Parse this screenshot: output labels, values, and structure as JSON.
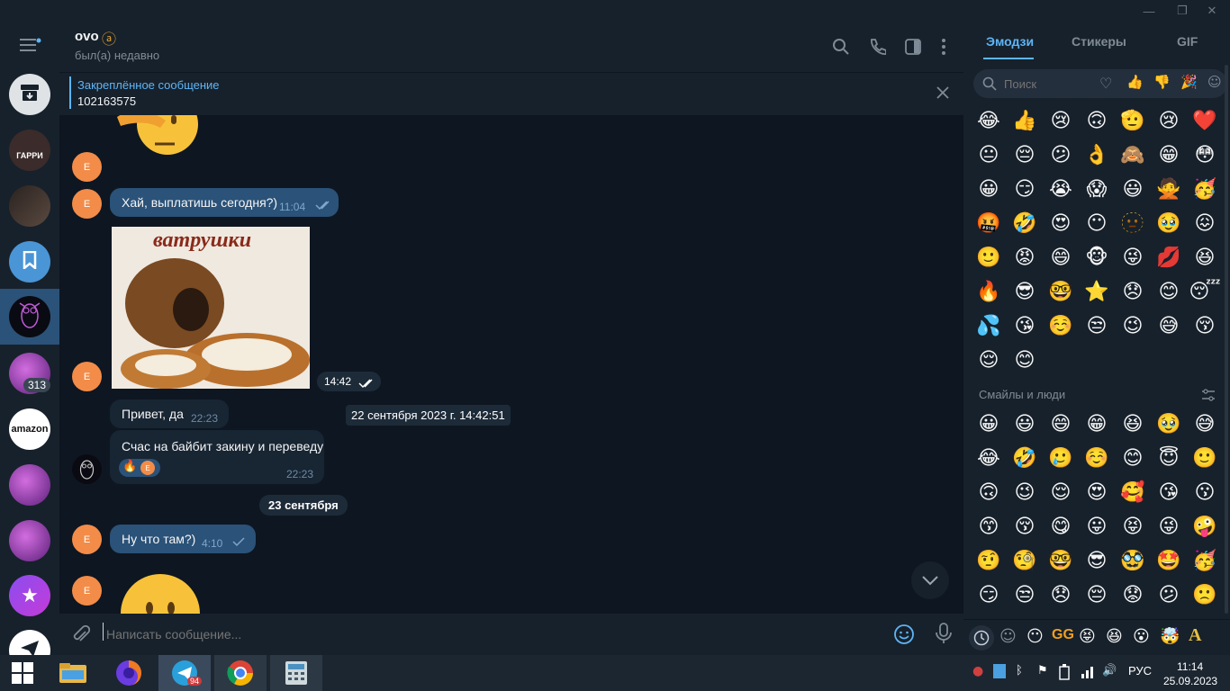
{
  "window": {
    "minimize_glyph": "—",
    "restore_glyph": "❐",
    "close_glyph": "✕"
  },
  "sidebar": {
    "menu_icon": "hamburger-menu-icon",
    "items": [
      {
        "name": "archive",
        "icon": "archive-icon"
      },
      {
        "name": "harry-channel",
        "caption": "ГАРРИ"
      },
      {
        "name": "photo-chat"
      },
      {
        "name": "saved-messages",
        "icon": "bookmark-icon"
      },
      {
        "name": "ovo-chat",
        "selected": true
      },
      {
        "name": "cryptoniks-1",
        "badge": "313"
      },
      {
        "name": "amazon-chat",
        "caption": "amazon"
      },
      {
        "name": "cryptoniks-2"
      },
      {
        "name": "cryptoniks-3"
      },
      {
        "name": "starred-chat"
      },
      {
        "name": "telegram-chat"
      }
    ]
  },
  "header": {
    "title": "ovo",
    "status": "был(а) недавно",
    "icons": [
      "search-icon",
      "phone-icon",
      "sidebar-toggle-icon",
      "more-vertical-icon"
    ]
  },
  "pinned": {
    "label": "Закреплённое сообщение",
    "text": "102163575"
  },
  "messages": [
    {
      "type": "text",
      "text": "Хай, выплатишь сегодня?)",
      "time": "11:04",
      "read": true,
      "avatar": "E"
    },
    {
      "type": "image",
      "caption_art": "ватрушки",
      "time": "14:42",
      "read": true,
      "avatar": "E"
    },
    {
      "type": "text",
      "text": "Привет, да",
      "time": "22:23",
      "avatar": ""
    },
    {
      "type": "tooltip",
      "text": "22 сентября 2023 г. 14:42:51"
    },
    {
      "type": "text",
      "text": "Счас на байбит закину и переведу",
      "time": "22:23",
      "reaction": "🔥",
      "reaction_user": "E"
    },
    {
      "type": "date",
      "text": "23 сентября"
    },
    {
      "type": "text",
      "text": "Ну что там?)",
      "time": "4:10",
      "read": false,
      "avatar": "E"
    }
  ],
  "composer": {
    "placeholder": "Написать сообщение...",
    "icons": [
      "attach-icon",
      "emoji-icon",
      "microphone-icon"
    ]
  },
  "emoji_panel": {
    "tabs": [
      "Эмодзи",
      "Стикеры",
      "GIF"
    ],
    "active_tab": "Эмодзи",
    "search_placeholder": "Поиск",
    "recent": [
      "😂",
      "👍",
      "😢",
      "🙃",
      "🫡",
      "😢",
      "❤️",
      "😐",
      "😔",
      "😕",
      "👌",
      "🙈",
      "😁",
      "😳",
      "😀",
      "😏",
      "😭",
      "😱",
      "😃",
      "🙅",
      "🥳",
      "🤬",
      "🤣",
      "😍",
      "😶",
      "🫥",
      "🥹",
      "😖",
      "🙂",
      "😡",
      "😄",
      "🐵",
      "😜",
      "💋",
      "😆",
      "🔥",
      "😎",
      "🤓",
      "⭐",
      "😞",
      "😊",
      "😴",
      "💦",
      "😘",
      "☺️",
      "😒",
      "😉",
      "😅",
      "😚",
      "😌",
      "😊"
    ],
    "section_title": "Смайлы и люди",
    "people": [
      "😀",
      "😃",
      "😄",
      "😁",
      "😆",
      "🥹",
      "😅",
      "😂",
      "🤣",
      "🥲",
      "☺️",
      "😊",
      "😇",
      "🙂",
      "🙃",
      "😉",
      "😌",
      "😍",
      "🥰",
      "😘",
      "😗",
      "😙",
      "😚",
      "😋",
      "😛",
      "😝",
      "😜",
      "🤪",
      "🤨",
      "🧐",
      "🤓",
      "😎",
      "🥸",
      "🤩",
      "🥳",
      "😏",
      "😒",
      "😞",
      "😔",
      "😟",
      "😕",
      "🙁"
    ],
    "bottom_icons": [
      "recent-clock-icon",
      "smile-category-icon",
      "emoji-pack-icon",
      "gg-sticker-icon",
      "emoji-pack-2-icon",
      "emoji-pack-3-icon",
      "emoji-pack-4-icon",
      "emoji-pack-5-icon",
      "letter-a-pack-icon"
    ]
  },
  "taskbar": {
    "apps": [
      "windows-start-icon",
      "file-explorer-icon",
      "firefox-icon",
      "telegram-icon",
      "chrome-icon",
      "calculator-icon"
    ],
    "telegram_badge": "94",
    "language": "РУС",
    "time": "11:14",
    "date": "25.09.2023"
  },
  "colors": {
    "bg": "#17212b",
    "chat_bg": "#0e1621",
    "accent": "#5eb5f7",
    "incoming_bubble": "#182533",
    "outgoing_bubble": "#2b5278",
    "avatar_orange": "#f28c48"
  }
}
